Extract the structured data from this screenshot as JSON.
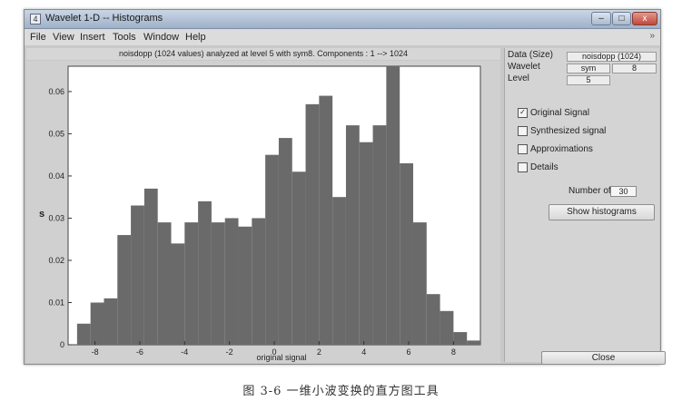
{
  "window": {
    "title": "Wavelet 1-D -- Histograms",
    "app_icon": "4",
    "min_glyph": "–",
    "max_glyph": "□",
    "close_glyph": "x"
  },
  "menu": {
    "items": [
      "File",
      "View",
      "Insert",
      "Tools",
      "Window",
      "Help"
    ],
    "overflow_glyph": "»"
  },
  "plot_header": "noisdopp (1024 values) analyzed at level 5 with sym8.  Components :   1 --> 1024",
  "chart_data": {
    "type": "bar",
    "xlabel": "original signal",
    "ylabel": "s",
    "xlim": [
      -9.2,
      9.2
    ],
    "ylim": [
      0,
      0.066
    ],
    "xticks": [
      -8,
      -6,
      -4,
      -2,
      0,
      2,
      4,
      6,
      8
    ],
    "yticks": [
      0,
      0.01,
      0.02,
      0.03,
      0.04,
      0.05,
      0.06
    ],
    "ytick_labels": [
      "0",
      "0.01",
      "0.02",
      "0.03",
      "0.04",
      "0.05",
      "0.06"
    ],
    "bar_color": "#6a6a6a",
    "bins": 30,
    "bin_start": -8.8,
    "bin_width": 0.6,
    "values": [
      0.005,
      0.01,
      0.011,
      0.026,
      0.033,
      0.037,
      0.029,
      0.024,
      0.029,
      0.034,
      0.029,
      0.03,
      0.028,
      0.03,
      0.045,
      0.049,
      0.041,
      0.057,
      0.059,
      0.035,
      0.052,
      0.048,
      0.052,
      0.066,
      0.043,
      0.029,
      0.012,
      0.008,
      0.003,
      0.001
    ]
  },
  "panel": {
    "data_label": "Data  (Size)",
    "data_value": "noisdopp   (1024)",
    "wavelet_label": "Wavelet",
    "wavelet_family": "sym",
    "wavelet_order": "8",
    "level_label": "Level",
    "level_value": "5",
    "checkboxes": [
      {
        "label": "Original Signal",
        "checked": true
      },
      {
        "label": "Synthesized signal",
        "checked": false
      },
      {
        "label": "Approximations",
        "checked": false
      },
      {
        "label": "Details",
        "checked": false
      }
    ],
    "numbins_label": "Number of",
    "numbins_value": "30",
    "show_button": "Show histograms",
    "close_button": "Close"
  },
  "caption": "图 3-6    一维小波变换的直方图工具"
}
